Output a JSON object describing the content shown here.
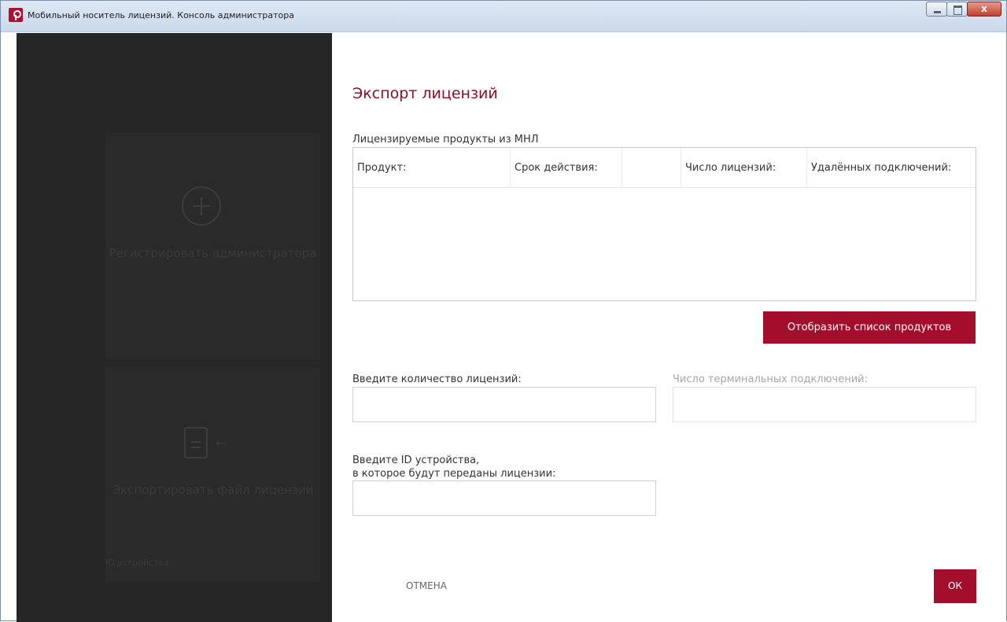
{
  "window": {
    "title": "Мобильный носитель лицензий. Консоль администратора",
    "close_label": "x"
  },
  "sidebar": {
    "register_label": "Регистрировать администратора",
    "export_label": "Экспортировать файл лицензии",
    "device_id_label": "ID устройства:"
  },
  "main": {
    "title": "Экспорт лицензий",
    "products_label": "Лицензируемые продукты из МНЛ",
    "table": {
      "columns": [
        "Продукт:",
        "Срок действия:",
        "",
        "Число лицензий:",
        "Удалённых подключений:"
      ]
    },
    "show_products_button": "Отобразить список продуктов",
    "license_count_label": "Введите количество  лицензий:",
    "license_count_value": "",
    "terminal_connections_label": "Число терминальных подключений:",
    "terminal_connections_value": "",
    "device_id_label_line1": "Введите ID устройства,",
    "device_id_label_line2": "в которое будут переданы лицензии:",
    "device_id_value": "",
    "cancel_button": "ОТМЕНА",
    "ok_button": "ОК"
  },
  "colors": {
    "accent": "#a30e2c",
    "sidebar": "#262626"
  }
}
